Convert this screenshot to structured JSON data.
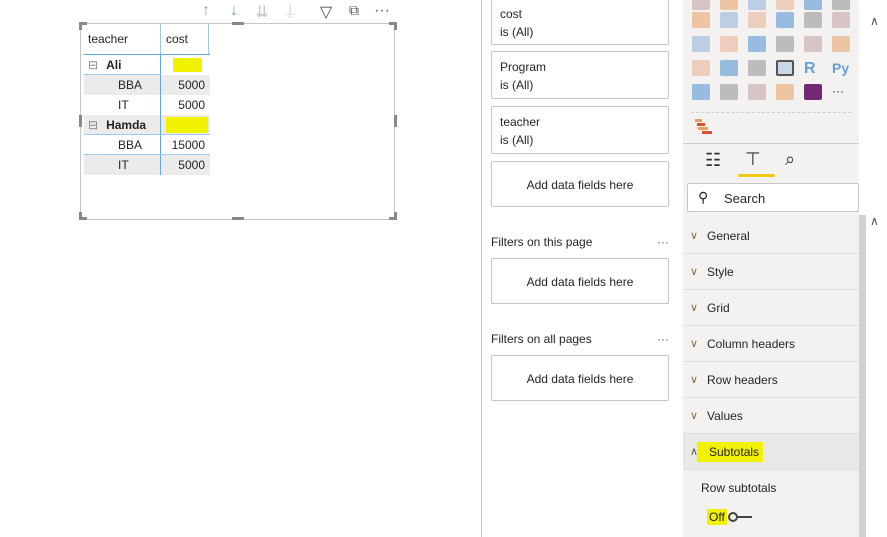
{
  "visual_header": {
    "icons": [
      "sort-ascending-icon",
      "sort-descending-icon",
      "expand-all-down-icon",
      "drill-hierarchy-icon",
      "filter-icon",
      "focus-mode-icon",
      "more-options-icon"
    ]
  },
  "matrix": {
    "columns": [
      "teacher",
      "cost"
    ],
    "rows": [
      {
        "label": "Ali",
        "level": 0,
        "value": "",
        "highlighted": true
      },
      {
        "label": "BBA",
        "level": 1,
        "value": "5000"
      },
      {
        "label": "IT",
        "level": 1,
        "value": "5000"
      },
      {
        "label": "Hamda",
        "level": 0,
        "value": "",
        "highlighted": true
      },
      {
        "label": "BBA",
        "level": 1,
        "value": "15000"
      },
      {
        "label": "IT",
        "level": 1,
        "value": "5000"
      }
    ]
  },
  "filters": {
    "visual_filters": [
      {
        "field": "cost",
        "state": "is (All)"
      },
      {
        "field": "Program",
        "state": "is (All)"
      },
      {
        "field": "teacher",
        "state": "is (All)"
      }
    ],
    "add_label": "Add data fields here",
    "page_label": "Filters on this page",
    "all_pages_label": "Filters on all pages",
    "more": "···"
  },
  "viz": {
    "search_placeholder": "Search",
    "more": "···",
    "sections": [
      "General",
      "Style",
      "Grid",
      "Column headers",
      "Row headers",
      "Values",
      "Subtotals"
    ],
    "row_subtotals_label": "Row subtotals",
    "row_subtotals_toggle": "Off",
    "accent": "#f2c811",
    "highlight": "#f2f200"
  }
}
